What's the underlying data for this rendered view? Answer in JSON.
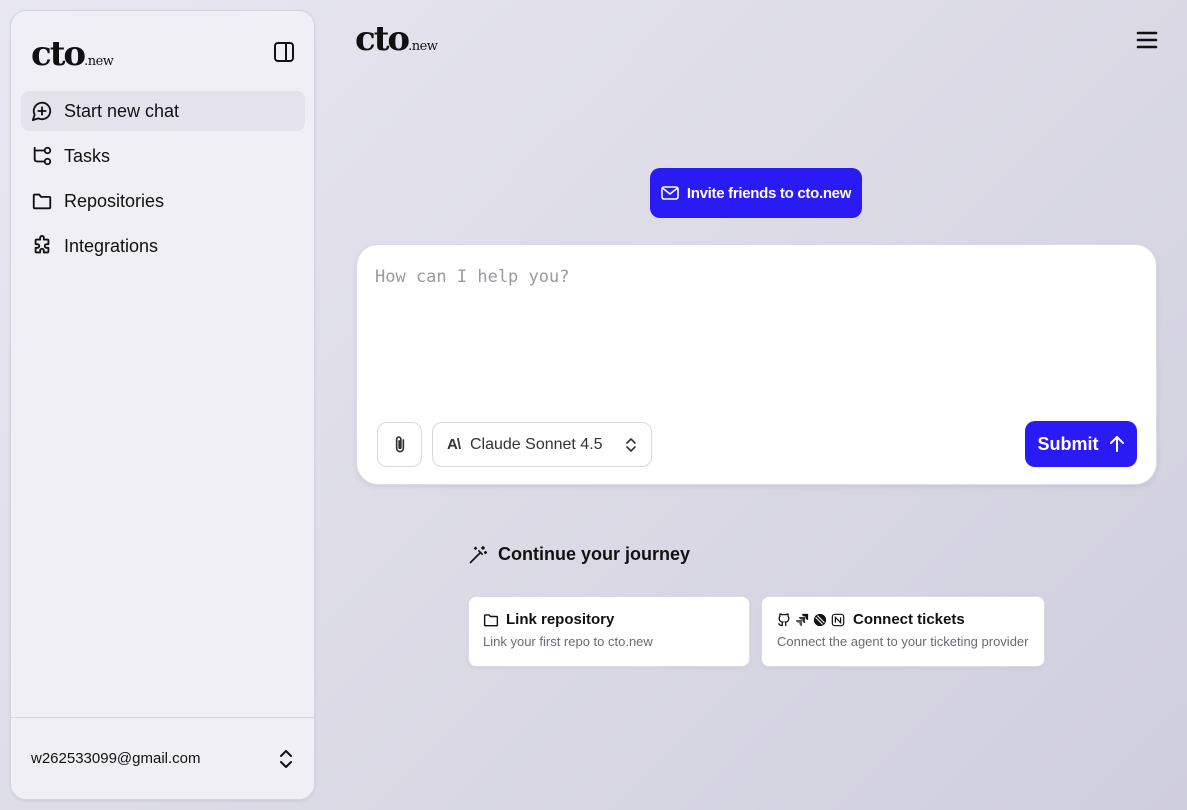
{
  "logo": {
    "word": "cto",
    "suffix": ".new"
  },
  "sidebar": {
    "items": [
      {
        "label": "Start new chat",
        "icon": "chat-plus-icon",
        "active": true
      },
      {
        "label": "Tasks",
        "icon": "git-branch-icon",
        "active": false
      },
      {
        "label": "Repositories",
        "icon": "folder-icon",
        "active": false
      },
      {
        "label": "Integrations",
        "icon": "puzzle-icon",
        "active": false
      }
    ],
    "account_email": "w262533099@gmail.com"
  },
  "invite": {
    "label": "Invite friends to cto.new"
  },
  "chat": {
    "placeholder": "How can I help you?",
    "model": "Claude Sonnet 4.5",
    "model_logo": "A\\",
    "submit_label": "Submit"
  },
  "journey": {
    "title": "Continue your journey",
    "cards": [
      {
        "title": "Link repository",
        "description": "Link your first repo to cto.new"
      },
      {
        "title": "Connect tickets",
        "description": "Connect the agent to your ticketing provider"
      }
    ]
  },
  "colors": {
    "accent": "#2a1af5",
    "background": "#e2e1eb"
  }
}
